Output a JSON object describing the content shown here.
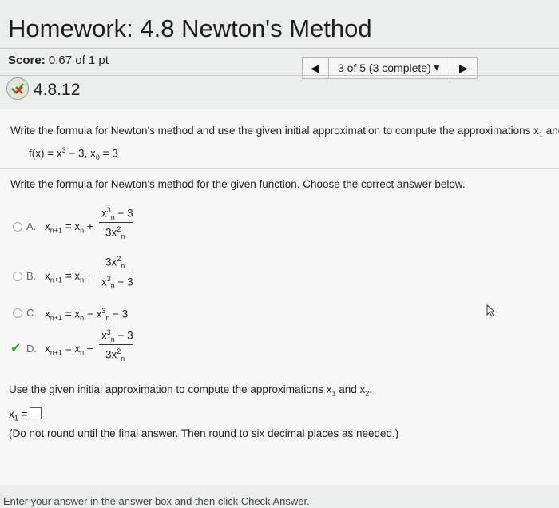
{
  "header": {
    "title": "Homework: 4.8 Newton's Method",
    "score_label": "Score:",
    "score_value": "0.67 of 1 pt",
    "nav_prev": "◀",
    "nav_label": "3 of 5 (3 complete)",
    "nav_caret": "▼",
    "nav_next": "▶"
  },
  "question": {
    "number": "4.8.12",
    "instruction": "Write the formula for Newton's method and use the given initial approximation to compute the approximations x",
    "function": "f(x) = x",
    "part1_prompt": "Write the formula for Newton's method for the given function. Choose the correct answer below.",
    "options": [
      {
        "letter": "A.",
        "selected": false
      },
      {
        "letter": "B.",
        "selected": false
      },
      {
        "letter": "C.",
        "selected": false
      },
      {
        "letter": "D.",
        "selected": true
      }
    ],
    "part2_prompt": "Use the given initial approximation to compute the approximations x",
    "answer_label": "x",
    "answer_value": "",
    "note": "(Do not round until the final answer. Then round to six decimal places as needed.)"
  },
  "footer": {
    "text": "Enter your answer in the answer box and then click Check Answer."
  },
  "colors": {
    "background": "#eceded",
    "section": "#f7f7f7",
    "check": "#4a9a3a"
  }
}
